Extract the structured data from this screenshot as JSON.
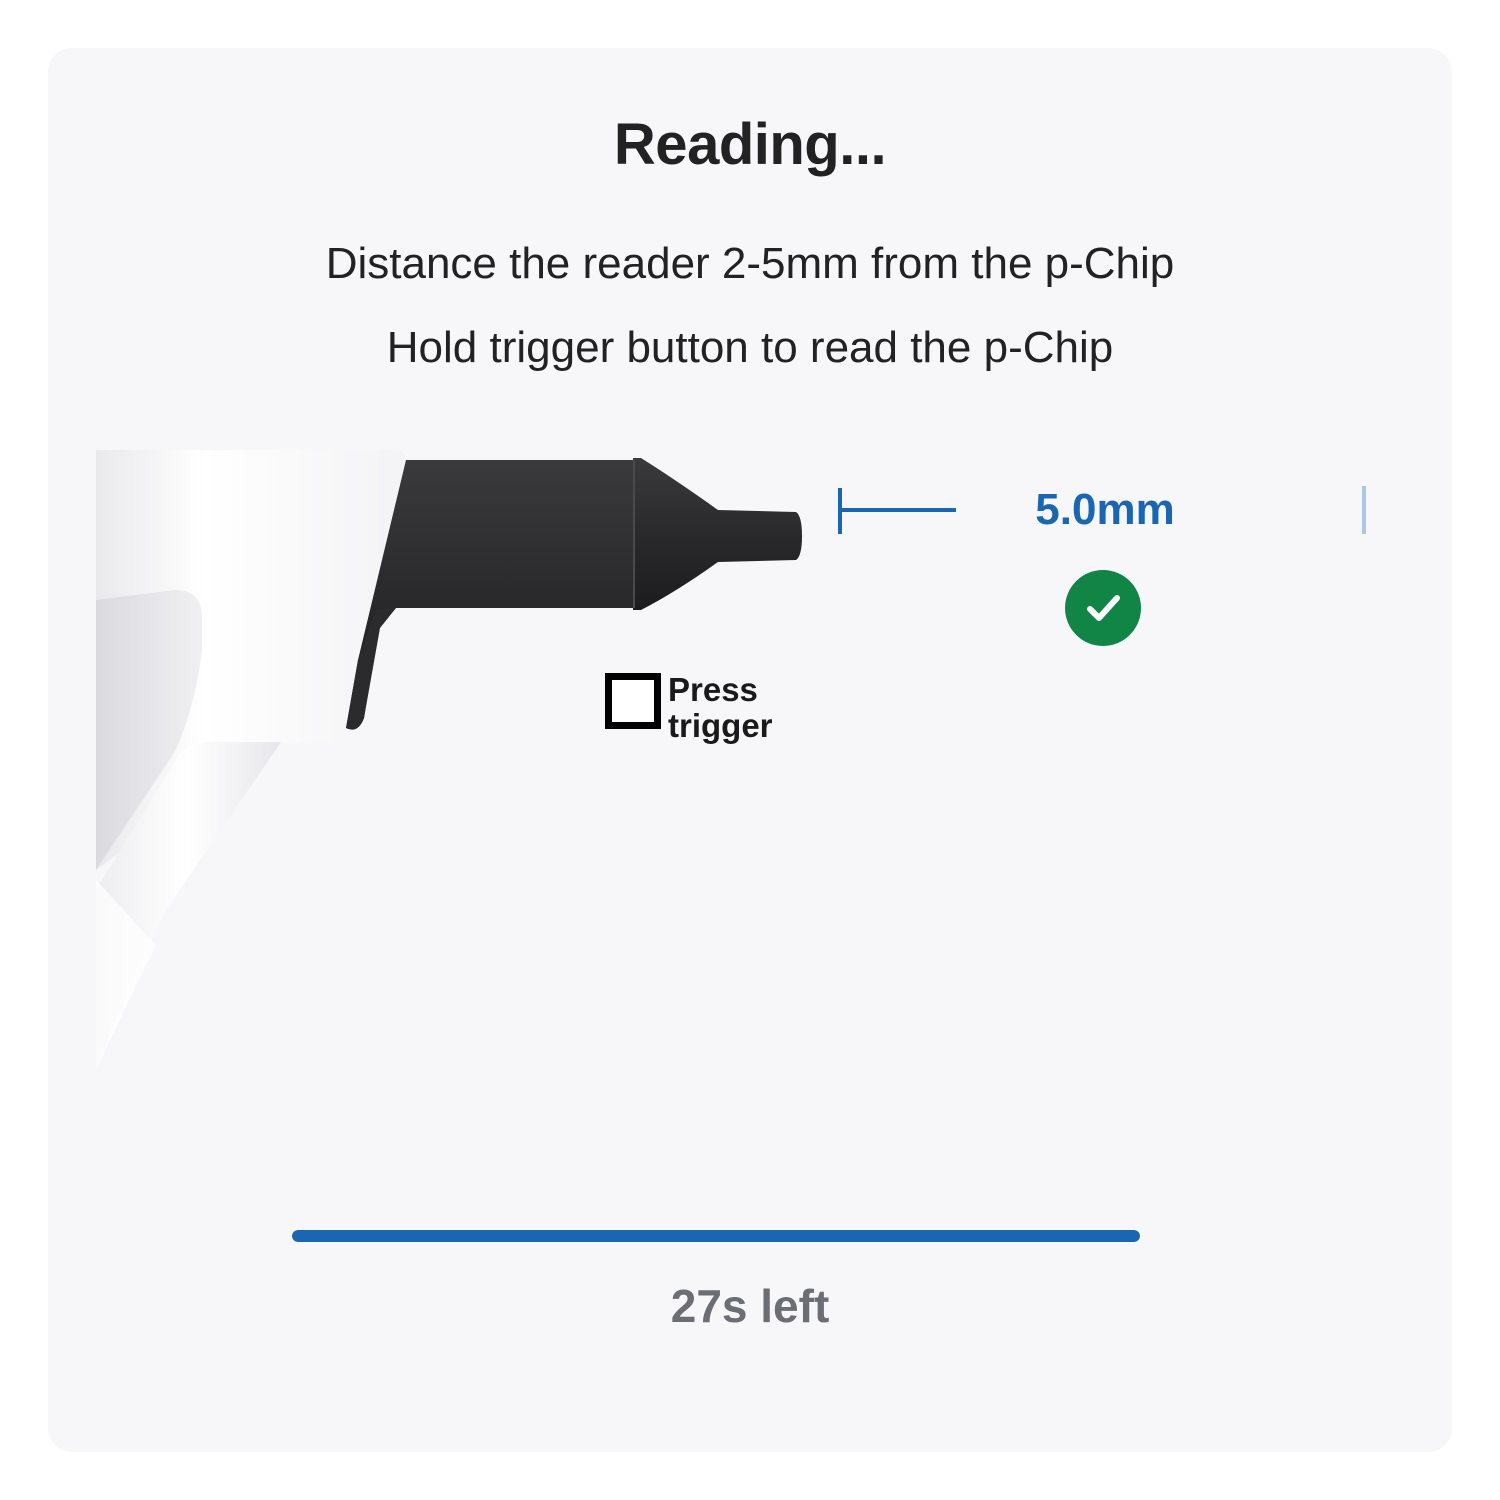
{
  "title": "Reading...",
  "instructions": [
    "Distance the reader 2-5mm from the p-Chip",
    "Hold trigger button to read the p-Chip"
  ],
  "distance": {
    "value_label": "5.0mm",
    "status_icon": "check-circle-icon",
    "status_color": "#108546"
  },
  "trigger": {
    "label_line1": "Press",
    "label_line2": "trigger",
    "checked": false
  },
  "progress": {
    "fraction": 1.0,
    "color": "#1a66b0"
  },
  "timer": {
    "text": "27s left"
  }
}
